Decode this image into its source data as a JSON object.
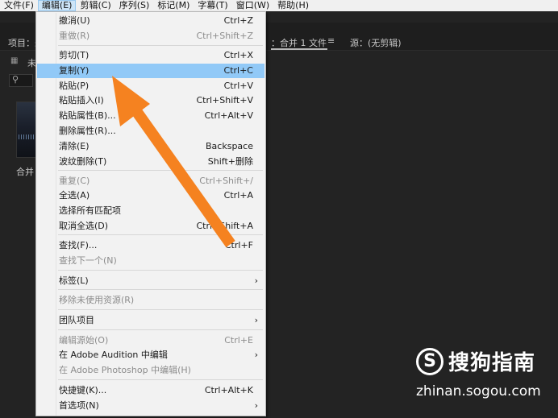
{
  "menubar": {
    "items": [
      "文件(F)",
      "编辑(E)",
      "剪辑(C)",
      "序列(S)",
      "标记(M)",
      "字幕(T)",
      "窗口(W)",
      "帮助(H)"
    ]
  },
  "panels": {
    "project_title": "项目：未",
    "timeline_title": "：合并 1 文件",
    "source_title": "源：(无剪辑)",
    "menu_glyph": "≡",
    "tab_fragment": "未",
    "clip_label": "合并"
  },
  "edit_menu": {
    "items": [
      {
        "label": "撤消(U)",
        "shortcut": "Ctrl+Z",
        "disabled": false
      },
      {
        "label": "重做(R)",
        "shortcut": "Ctrl+Shift+Z",
        "disabled": true
      },
      {
        "label": "剪切(T)",
        "shortcut": "Ctrl+X",
        "disabled": false
      },
      {
        "label": "复制(Y)",
        "shortcut": "Ctrl+C",
        "disabled": false,
        "highlighted": true
      },
      {
        "label": "粘贴(P)",
        "shortcut": "Ctrl+V",
        "disabled": false
      },
      {
        "label": "粘贴插入(I)",
        "shortcut": "Ctrl+Shift+V",
        "disabled": false
      },
      {
        "label": "粘贴属性(B)...",
        "shortcut": "Ctrl+Alt+V",
        "disabled": false
      },
      {
        "label": "删除属性(R)...",
        "shortcut": "",
        "disabled": false
      },
      {
        "label": "清除(E)",
        "shortcut": "Backspace",
        "disabled": false
      },
      {
        "label": "波纹删除(T)",
        "shortcut": "Shift+删除",
        "disabled": false
      },
      {
        "label": "重复(C)",
        "shortcut": "Ctrl+Shift+/",
        "disabled": true
      },
      {
        "label": "全选(A)",
        "shortcut": "Ctrl+A",
        "disabled": false
      },
      {
        "label": "选择所有匹配项",
        "shortcut": "",
        "disabled": false
      },
      {
        "label": "取消全选(D)",
        "shortcut": "Ctrl+Shift+A",
        "disabled": false
      },
      {
        "label": "查找(F)...",
        "shortcut": "Ctrl+F",
        "disabled": false
      },
      {
        "label": "查找下一个(N)",
        "shortcut": "",
        "disabled": true
      },
      {
        "label": "标签(L)",
        "shortcut": "",
        "disabled": false,
        "submenu": true
      },
      {
        "label": "移除未使用资源(R)",
        "shortcut": "",
        "disabled": true
      },
      {
        "label": "团队项目",
        "shortcut": "",
        "disabled": false,
        "submenu": true
      },
      {
        "label": "编辑源始(O)",
        "shortcut": "Ctrl+E",
        "disabled": true
      },
      {
        "label": "在 Adobe Audition 中编辑",
        "shortcut": "",
        "disabled": false,
        "submenu": true
      },
      {
        "label": "在 Adobe Photoshop 中编辑(H)",
        "shortcut": "",
        "disabled": true
      },
      {
        "label": "快捷键(K)...",
        "shortcut": "Ctrl+Alt+K",
        "disabled": false
      },
      {
        "label": "首选项(N)",
        "shortcut": "",
        "disabled": false,
        "submenu": true
      }
    ]
  },
  "watermark": {
    "logo_letter": "S",
    "text": "搜狗指南",
    "url": "zhinan.sogou.com"
  },
  "colors": {
    "highlight": "#91c9f7",
    "arrow": "#f58220",
    "app_background": "#232323"
  }
}
